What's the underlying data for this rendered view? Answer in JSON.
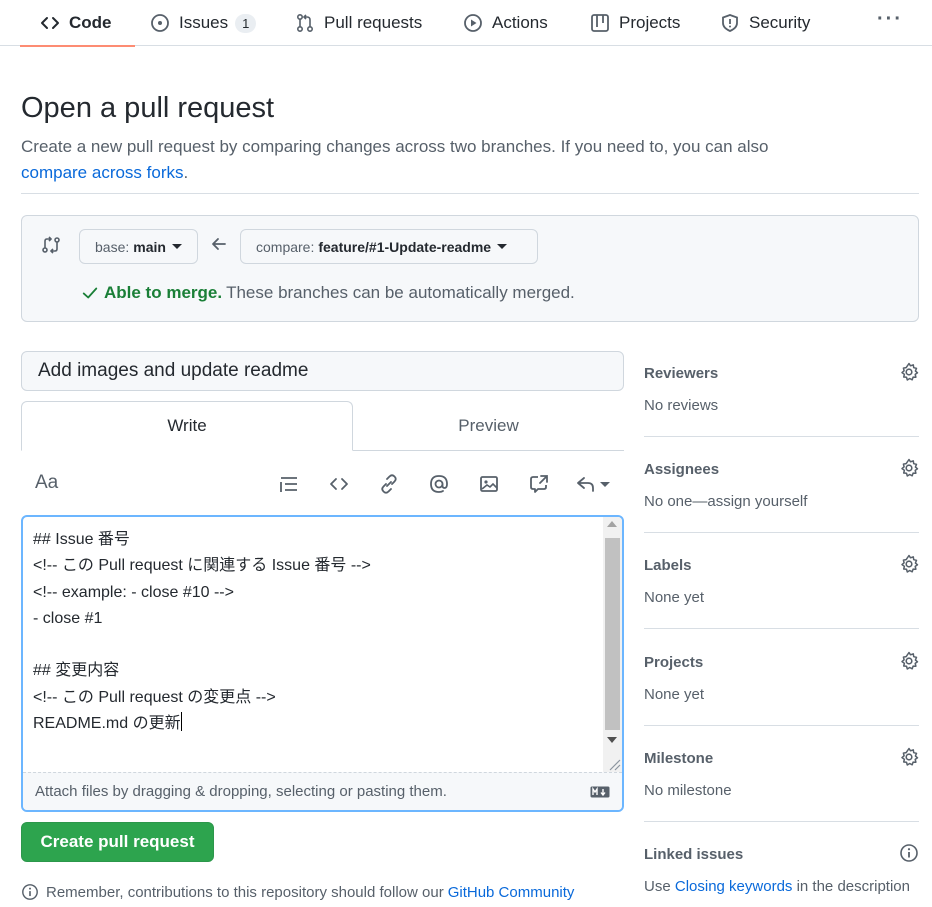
{
  "nav": {
    "code": "Code",
    "issues": "Issues",
    "issues_count": "1",
    "pull_requests": "Pull requests",
    "actions": "Actions",
    "projects": "Projects",
    "security": "Security",
    "more": "···"
  },
  "header": {
    "title": "Open a pull request",
    "subtitle": "Create a new pull request by comparing changes across two branches. If you need to, you can also",
    "forks_link": "compare across forks",
    "forks_suffix": "."
  },
  "range": {
    "base_label": "base:",
    "base_branch": "main",
    "compare_label": "compare:",
    "compare_branch": "feature/#1-Update-readme",
    "merge_ok": "Able to merge.",
    "merge_text": "These branches can be automatically merged."
  },
  "form": {
    "title_value": "Add images and update readme",
    "tab_write": "Write",
    "tab_preview": "Preview",
    "text_tool": "Aa",
    "body": "## Issue 番号\n<!-- この Pull request に関連する Issue 番号 -->\n<!-- example: - close #10 -->\n- close #1\n\n## 変更内容\n<!-- この Pull request の変更点 -->\nREADME.md の更新",
    "attach_hint": "Attach files by dragging & dropping, selecting or pasting them.",
    "create_button": "Create pull request",
    "remember_text": "Remember, contributions to this repository should follow our",
    "remember_link": "GitHub Community"
  },
  "sidebar": {
    "reviewers": {
      "label": "Reviewers",
      "value": "No reviews"
    },
    "assignees": {
      "label": "Assignees",
      "value": "No one—assign yourself"
    },
    "labels": {
      "label": "Labels",
      "value": "None yet"
    },
    "projects": {
      "label": "Projects",
      "value": "None yet"
    },
    "milestone": {
      "label": "Milestone",
      "value": "No milestone"
    },
    "linked_issues": {
      "label": "Linked issues",
      "prefix": "Use",
      "link": "Closing keywords",
      "suffix": "in the description"
    }
  },
  "colors": {
    "accent_link": "#0969da",
    "success_green": "#1a7f37",
    "button_green": "#2da44e",
    "active_tab_underline": "#fd8c73"
  }
}
